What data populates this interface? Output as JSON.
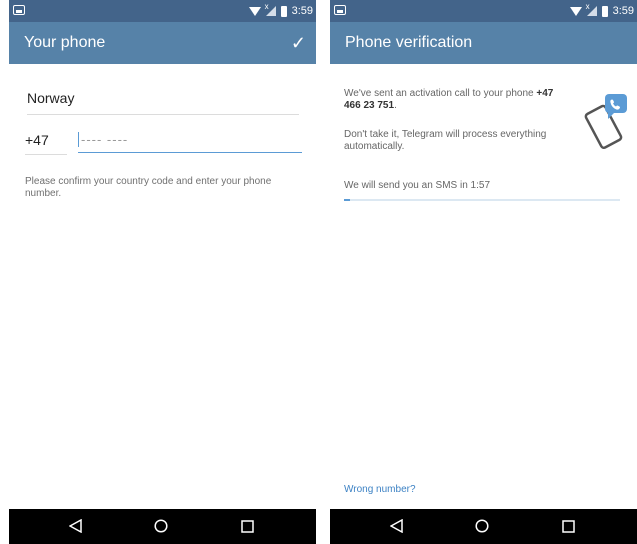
{
  "status_bar": {
    "time": "3:59"
  },
  "left_screen": {
    "title": "Your phone",
    "country": "Norway",
    "country_code": "+47",
    "phone_placeholder": "---- ----",
    "hint": "Please confirm your country code and enter your phone number."
  },
  "right_screen": {
    "title": "Phone verification",
    "message_prefix": "We've sent an activation call to your phone ",
    "message_number": "+47 466 23 751",
    "message_suffix": ".",
    "auto_message": "Don't take it, Telegram will process everything automatically.",
    "sms_timer": "We will send you an SMS in 1:57",
    "progress_fraction": 0.02,
    "wrong_number_link": "Wrong number?"
  },
  "nav": {
    "back_icon": "back-triangle-icon",
    "home_icon": "home-circle-icon",
    "recents_icon": "recents-square-icon"
  },
  "colors": {
    "status_bar": "#43648a",
    "app_bar": "#5682a8",
    "accent": "#5b9bd5",
    "link": "#3d82c4"
  }
}
